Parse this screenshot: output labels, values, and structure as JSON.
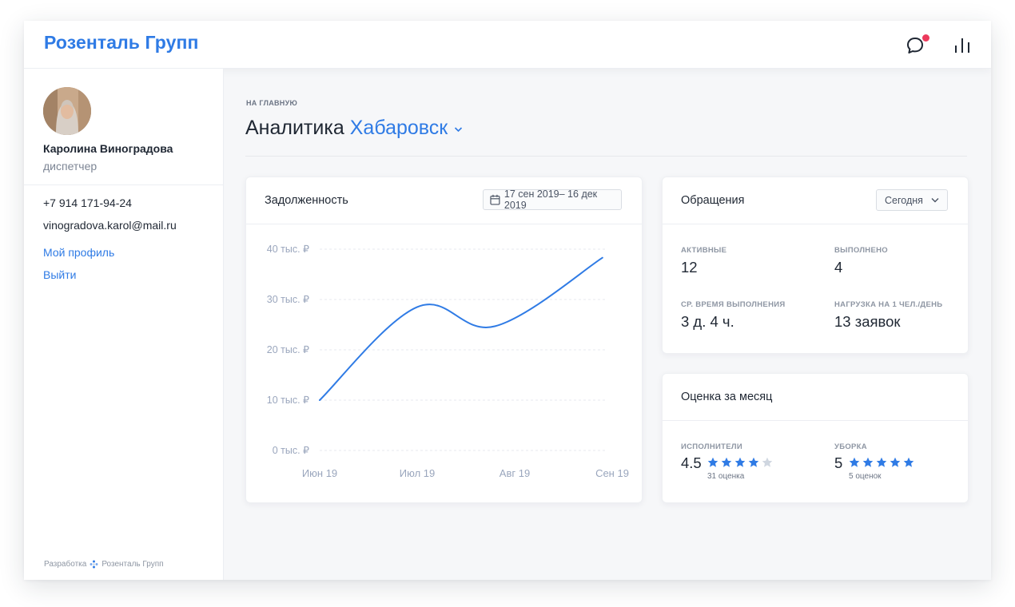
{
  "app": {
    "logo": "Розенталь Групп",
    "colors": {
      "accent": "#2f7be5",
      "notification": "#ec3a5c",
      "text": "#1f2733",
      "muted": "#8e96a3"
    },
    "icons": {
      "chat": "chat-bubble-icon",
      "stats": "bar-chart-icon"
    }
  },
  "sidebar": {
    "user_name": "Каролина Виноградова",
    "user_role": "диспетчер",
    "phone": "+7 914 171-94-24",
    "email": "vinogradova.karol@mail.ru",
    "profile_link": "Мой профиль",
    "logout_link": "Выйти",
    "footer_prefix": "Разработка",
    "footer_company": "Розенталь Групп"
  },
  "main": {
    "breadcrumb": "НА ГЛАВНУЮ",
    "title": "Аналитика",
    "city": "Хабаровск"
  },
  "debt": {
    "title": "Задолженность",
    "date_range": "17 сен 2019– 16 дек 2019"
  },
  "requests": {
    "title": "Обращения",
    "period": "Сегодня",
    "active_label": "АКТИВНЫЕ",
    "active_value": "12",
    "done_label": "ВЫПОЛНЕНО",
    "done_value": "4",
    "avg_label": "СР. ВРЕМЯ ВЫПОЛНЕНИЯ",
    "avg_value": "3 д. 4 ч.",
    "load_label": "НАГРУЗКА НА 1 ЧЕЛ./ДЕНЬ",
    "load_value": "13 заявок"
  },
  "rating": {
    "title": "Оценка за месяц",
    "performers_label": "ИСПОЛНИТЕЛИ",
    "performers_score": "4.5",
    "performers_stars": 4,
    "performers_count": "31 оценка",
    "cleaning_label": "УБОРКА",
    "cleaning_score": "5",
    "cleaning_stars": 5,
    "cleaning_count": "5 оценок"
  },
  "chart_data": {
    "type": "line",
    "title": "Задолженность",
    "categories": [
      "Июн 19",
      "Июл 19",
      "Авг 19",
      "Сен 19"
    ],
    "x": [
      0,
      1,
      1.8,
      2.9
    ],
    "y_ticks": [
      "0 тыс. ₽",
      "10 тыс. ₽",
      "20 тыс. ₽",
      "30 тыс. ₽",
      "40 тыс. ₽"
    ],
    "ylim": [
      0,
      40
    ],
    "series": [
      {
        "values": [
          10,
          28.5,
          24.7,
          38.3
        ]
      }
    ],
    "line_color": "#2f7be5",
    "grid": true
  }
}
